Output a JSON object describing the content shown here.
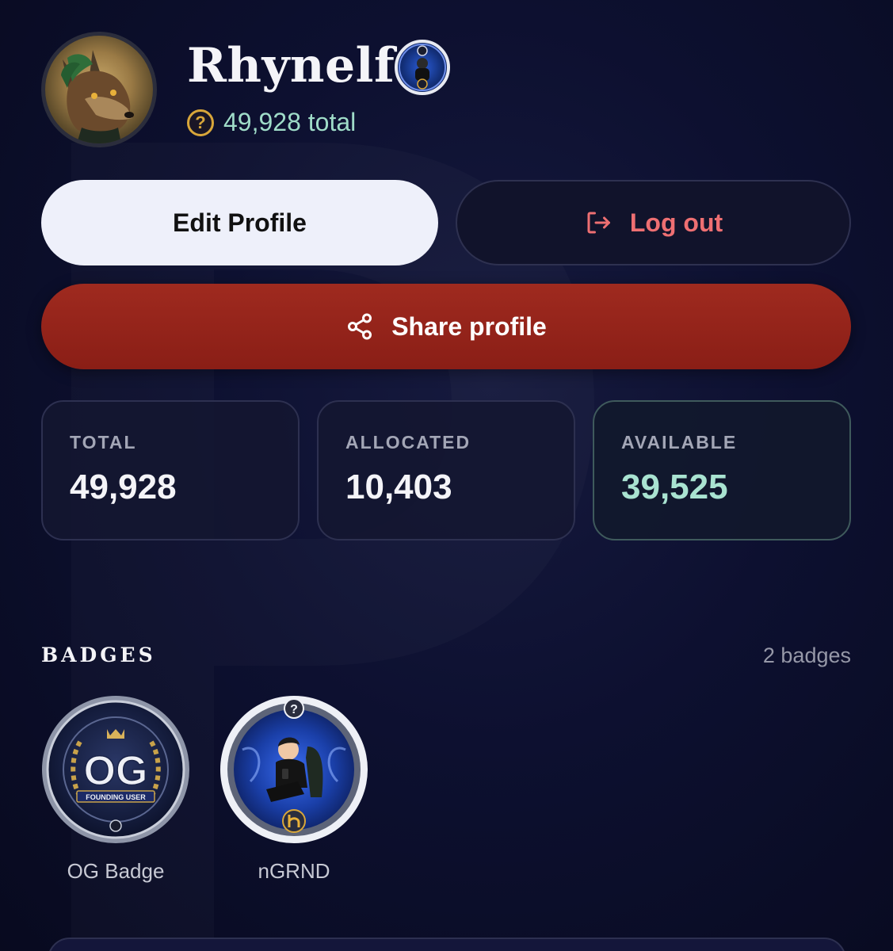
{
  "profile": {
    "username": "Rhynelf",
    "coin_symbol": "?",
    "total_points": "49,928 total"
  },
  "actions": {
    "edit_label": "Edit Profile",
    "logout_label": "Log out",
    "share_label": "Share profile"
  },
  "stats": [
    {
      "label": "TOTAL",
      "value": "49,928"
    },
    {
      "label": "ALLOCATED",
      "value": "10,403"
    },
    {
      "label": "AVAILABLE",
      "value": "39,525"
    }
  ],
  "badges": {
    "title": "BADGES",
    "count": "2 badges",
    "items": [
      {
        "label": "OG Badge",
        "art_text": "OG",
        "art_sub": "FOUNDING USER"
      },
      {
        "label": "nGRND"
      }
    ]
  },
  "colors": {
    "background": "#0b0d24",
    "accent_red": "#8a1e16",
    "logout_text": "#ee6f72",
    "available_value": "#a9e3d1",
    "coin": "#d8a63a"
  }
}
